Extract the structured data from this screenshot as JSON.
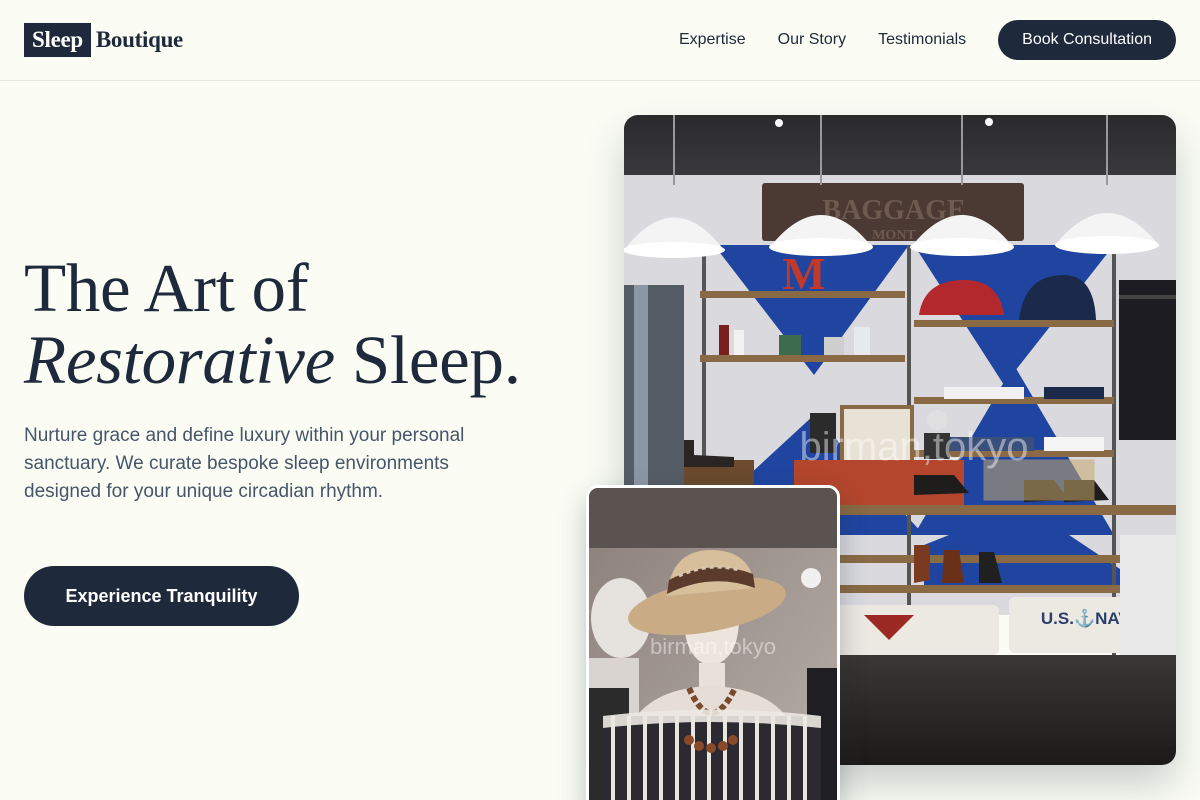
{
  "brand": {
    "highlight": "Sleep",
    "rest": "Boutique"
  },
  "nav": {
    "links": [
      "Expertise",
      "Our Story",
      "Testimonials"
    ],
    "cta": "Book Consultation"
  },
  "hero": {
    "line1": "The Art of",
    "line2_italic": "Restorative",
    "line2_rest": " Sleep.",
    "description": "Nurture grace and define luxury within your personal sanctuary. We curate bespoke sleep environments designed for your unique circadian rhythm.",
    "button": "Experience Tranquility"
  },
  "images": {
    "main": {
      "sign": "BAGGAGE",
      "sign_sub": "MONT",
      "letter": "M",
      "shirt_text": "U.S.⚓NAVY",
      "watermark": "birman,tokyo"
    },
    "secondary": {
      "watermark": "birman,tokyo"
    }
  },
  "colors": {
    "background": "#fbfdf5",
    "primary": "#1e293b",
    "muted_text": "#475569",
    "accent_blue": "#1f45a0"
  }
}
